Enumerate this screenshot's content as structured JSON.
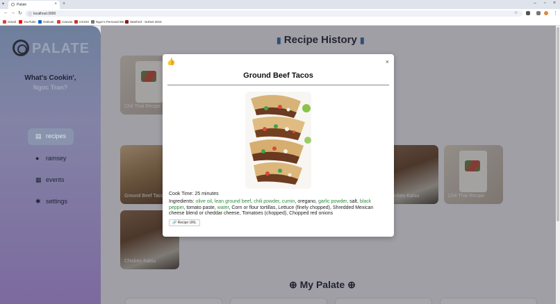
{
  "browser": {
    "tab_title": "Palate",
    "url": "localhost:3000",
    "bookmarks": [
      {
        "label": "Gmail",
        "color": "#d44638"
      },
      {
        "label": "YouTube",
        "color": "#ff0000"
      },
      {
        "label": "Outlook",
        "color": "#0a64c8"
      },
      {
        "label": "Canvas",
        "color": "#e03c31"
      },
      {
        "label": "CS103",
        "color": "#c0392b"
      },
      {
        "label": "Ngoc's Personal We...",
        "color": "#777777"
      },
      {
        "label": "Stanford - SUNet 2023",
        "color": "#8c1515"
      }
    ]
  },
  "sidebar": {
    "logo_text": "PALATE",
    "greeting": "What's Cookin',",
    "user_name": "Ngoc Tran?",
    "nav": [
      {
        "label": "recipes",
        "icon": "recipe-book-icon"
      },
      {
        "label": "ramsey",
        "icon": "robot-icon"
      },
      {
        "label": "events",
        "icon": "calendar-icon"
      },
      {
        "label": "settings",
        "icon": "gear-icon"
      }
    ]
  },
  "main": {
    "history_title": "Recipe History",
    "palate_title": "My Palate",
    "cards": [
      {
        "label": "Chè Thái Recipe"
      },
      {
        "label": "Ground Beef Tacos"
      },
      {
        "label": "Chicken Katsu"
      },
      {
        "label": "Chè Thái Recipe"
      },
      {
        "label": "Chicken Katsu"
      }
    ]
  },
  "modal": {
    "title": "Ground Beef Tacos",
    "cook_time": "Cook Time: 25 minutes",
    "ingredients_label": "Ingredients:",
    "ingredients": [
      {
        "text": "olive oil",
        "highlight": true
      },
      {
        "text": "lean ground beef",
        "highlight": true
      },
      {
        "text": "chili powder",
        "highlight": true
      },
      {
        "text": "cumin",
        "highlight": true
      },
      {
        "text": "oregano",
        "highlight": false
      },
      {
        "text": "garlic powder",
        "highlight": true
      },
      {
        "text": "salt",
        "highlight": false
      },
      {
        "text": "black pepper",
        "highlight": true
      },
      {
        "text": "tomato paste",
        "highlight": false
      },
      {
        "text": "water",
        "highlight": true
      },
      {
        "text": "Corn or flour tortillas",
        "highlight": false
      },
      {
        "text": "Lettuce (finely chopped)",
        "highlight": false
      },
      {
        "text": "Shredded Mexican cheese blend or cheddar cheese",
        "highlight": false
      },
      {
        "text": "Tomatoes (chopped)",
        "highlight": false
      },
      {
        "text": "Chopped red onions",
        "highlight": false
      }
    ],
    "url_button": "Recipe URL",
    "close_symbol": "×",
    "highlight_color": "#2e8b3e"
  }
}
